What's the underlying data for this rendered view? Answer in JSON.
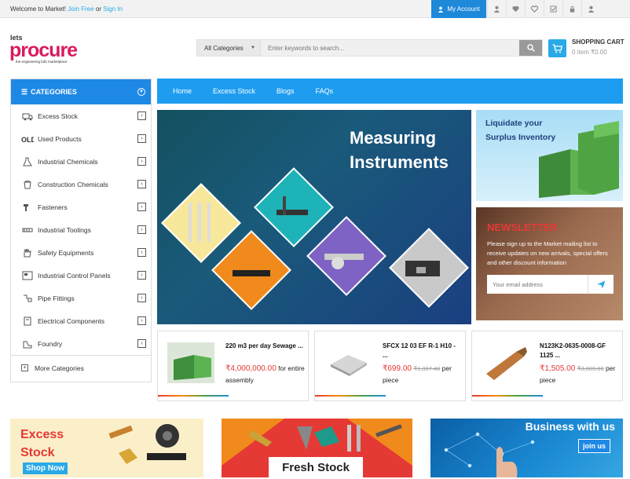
{
  "topbar": {
    "welcome": "Welcome to Market!",
    "join": "Join Free",
    "or": "or",
    "signin": "Sign In",
    "account": "My Account"
  },
  "logo": {
    "lets": "lets",
    "brand": "procure",
    "tagline": "the engineering b2b marketplace"
  },
  "search": {
    "category": "All Categories",
    "placeholder": "Enter keywords to search..."
  },
  "cart": {
    "title": "SHOPPING CART",
    "summary": "0 item ₹0.00"
  },
  "categories": {
    "heading": "CATEGORIES",
    "items": [
      {
        "label": "Excess Stock",
        "icon": "truck-icon"
      },
      {
        "label": "Used Products",
        "icon": "old-tag-icon"
      },
      {
        "label": "Industrial Chemicals",
        "icon": "flask-icon"
      },
      {
        "label": "Construction Chemicals",
        "icon": "bucket-icon"
      },
      {
        "label": "Fasteners",
        "icon": "bolt-icon"
      },
      {
        "label": "Industrial Toolings",
        "icon": "tools-icon"
      },
      {
        "label": "Safety Equipments",
        "icon": "glove-icon"
      },
      {
        "label": "Industrial Control Panels",
        "icon": "panel-icon"
      },
      {
        "label": "Pipe Fittings",
        "icon": "pipe-icon"
      },
      {
        "label": "Electrical Components",
        "icon": "electrical-icon"
      },
      {
        "label": "Foundry",
        "icon": "foundry-icon"
      }
    ],
    "more": "More Categories"
  },
  "nav": [
    "Home",
    "Excess Stock",
    "Blogs",
    "FAQs"
  ],
  "main_banner": {
    "line1": "Measuring",
    "line2": "Instruments"
  },
  "side_banner": {
    "line1": "Liquidate your",
    "line2": "Surplus Inventory"
  },
  "newsletter": {
    "title": "NEWSLETTER",
    "desc": "Please sign up to the Market mailing list to receive updates on new arrivals, special offers and other discount information",
    "placeholder": "Your email address"
  },
  "products": [
    {
      "name": "220 m3 per day Sewage ...",
      "price": "₹4,000,000.00",
      "old": "",
      "suffix": "for entire assembly"
    },
    {
      "name": "SFCX 12 03 EF R-1 H10 - ...",
      "price": "₹699.00",
      "old": "₹1,397.40",
      "suffix": "per piece"
    },
    {
      "name": "N123K2-0635-0008-GF 1125 ...",
      "price": "₹1,505.00",
      "old": "₹3,009.00",
      "suffix": "per piece"
    }
  ],
  "bottom_banners": {
    "excess1": "Excess",
    "excess2": "Stock",
    "shop_now": "Shop Now",
    "fresh": "Fresh Stock",
    "business": "Business with us",
    "join": "join us"
  },
  "colors": {
    "accent": "#1e88e5",
    "nav": "#1e9df0",
    "price": "#e53935"
  }
}
